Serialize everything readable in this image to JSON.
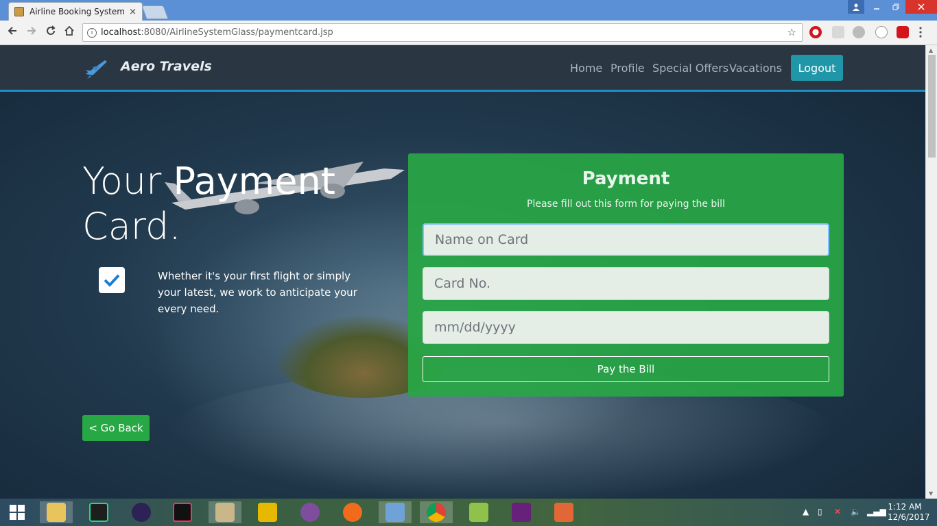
{
  "browser": {
    "tab_title": "Airline Booking System",
    "tab_close": "×",
    "url_host": "localhost",
    "url_path": ":8080/AirlineSystemGlass/paymentcard.jsp"
  },
  "navbar": {
    "brand": "Aero Travels",
    "links": [
      "Home",
      "Profile",
      "Special Offers",
      "Vacations"
    ],
    "logout": "Logout"
  },
  "hero": {
    "title_light_1": "Your ",
    "title_bold": "Payment",
    "title_light_2": "Card.",
    "feature_text": "Whether it's your first flight or simply your latest, we work to anticipate your every need."
  },
  "go_back": "< Go Back",
  "payment": {
    "title": "Payment",
    "subtitle": "Please fill out this form for paying the bill",
    "name_placeholder": "Name on Card",
    "card_placeholder": "Card No.",
    "date_placeholder": "mm/dd/yyyy",
    "pay_button": "Pay the Bill"
  },
  "taskbar": {
    "time": "1:12 AM",
    "date": "12/6/2017"
  },
  "colors": {
    "panel": "#28a745",
    "navbar": "#2a3642",
    "accent": "#1e8fc4",
    "logout": "#1f97a8"
  }
}
